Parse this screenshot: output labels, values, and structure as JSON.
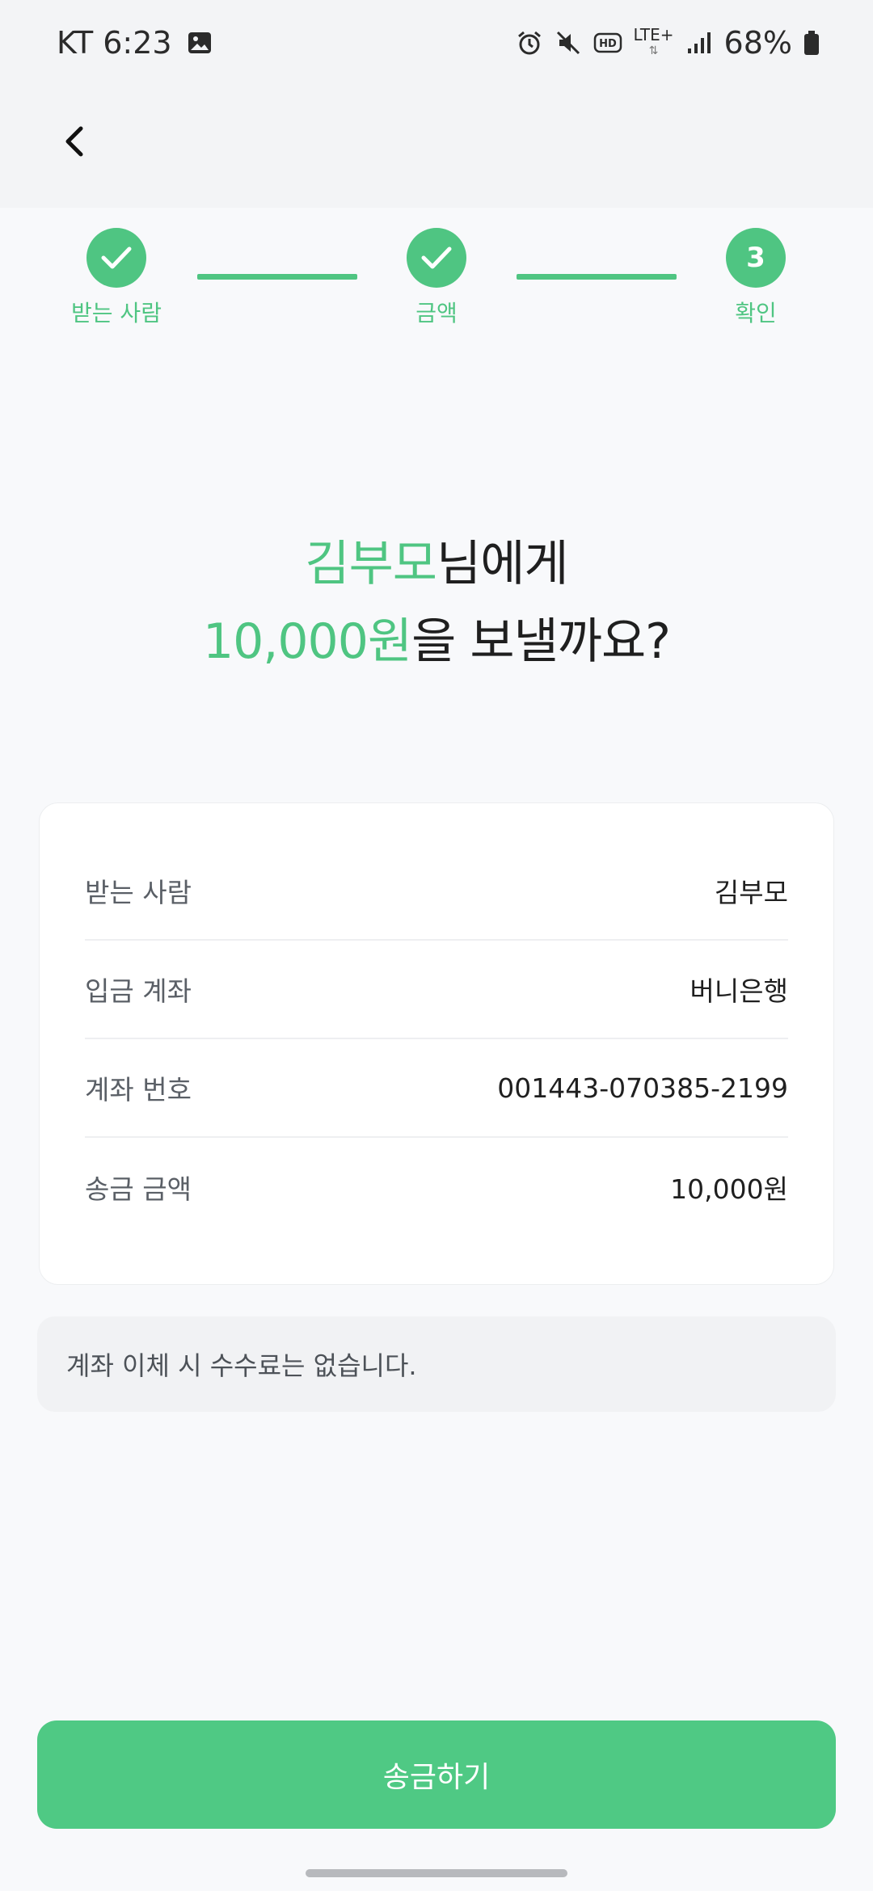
{
  "status_bar": {
    "carrier_time": "KT 6:23",
    "network": "LTE+",
    "battery": "68%",
    "icons": [
      "gallery-icon",
      "alarm-icon",
      "mute-icon",
      "hd-icon",
      "lte-icon",
      "signal-icon",
      "battery-icon"
    ]
  },
  "header": {
    "back_icon": "chevron-left-icon"
  },
  "stepper": {
    "steps": [
      {
        "label": "받는 사람",
        "state": "done"
      },
      {
        "label": "금액",
        "state": "done"
      },
      {
        "label": "확인",
        "number": "3",
        "state": "current"
      }
    ]
  },
  "title": {
    "recipient": "김부모",
    "recipient_suffix": "님에게",
    "amount": "10,000원",
    "amount_suffix": "을 보낼까요?"
  },
  "details": [
    {
      "label": "받는 사람",
      "value": "김부모"
    },
    {
      "label": "입금 계좌",
      "value": "버니은행"
    },
    {
      "label": "계좌 번호",
      "value": "001443-070385-2199"
    },
    {
      "label": "송금 금액",
      "value": "10,000원"
    }
  ],
  "notice": "계좌 이체 시 수수료는 없습니다.",
  "send_button": "송금하기",
  "colors": {
    "accent": "#4fc582",
    "button": "#4fc984",
    "background": "#f8f9fb"
  }
}
